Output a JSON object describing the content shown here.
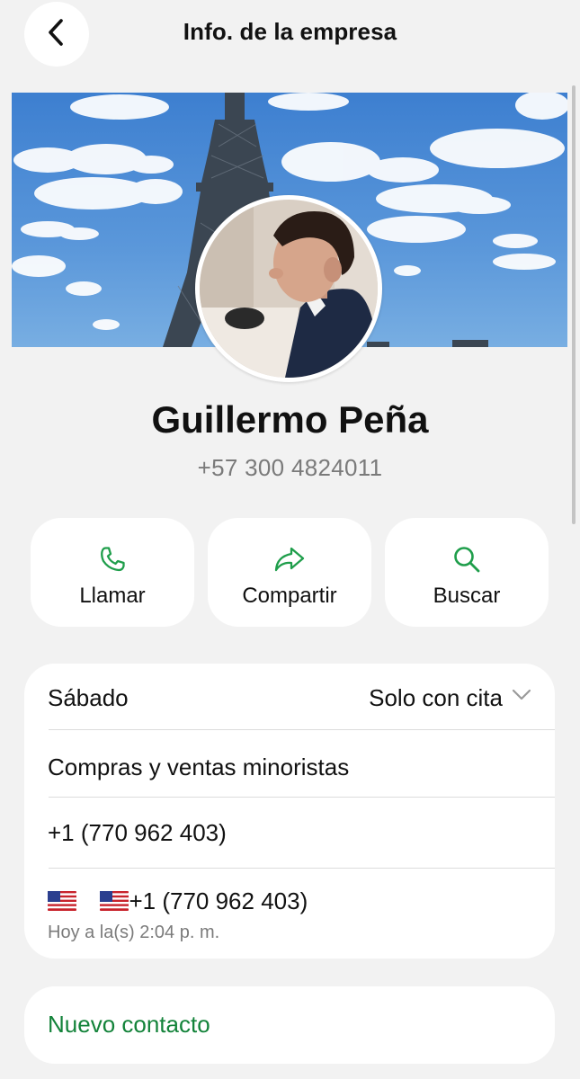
{
  "header": {
    "title": "Info. de la empresa",
    "back_icon": "chevron-left-icon"
  },
  "profile": {
    "name": "Guillermo Peña",
    "phone": "+57 300 4824011"
  },
  "actions": [
    {
      "label": "Llamar",
      "icon": "phone-icon"
    },
    {
      "label": "Compartir",
      "icon": "share-arrow-icon"
    },
    {
      "label": "Buscar",
      "icon": "search-icon"
    }
  ],
  "info": {
    "hours_day": "Sábado",
    "hours_value": "Solo con cita",
    "category": "Compras y ventas minoristas",
    "phone_business": "+1 (770 962 403)",
    "phone_flagged": "+1 (770 962 403)",
    "flag_icon": "us-flag-icon",
    "timestamp": "Hoy a la(s) 2:04 p. m."
  },
  "new_contact": "Nuevo contacto",
  "colors": {
    "accent_green": "#13833a",
    "icon_green": "#1f9e4b",
    "background": "#f2f2f2",
    "card": "#ffffff",
    "secondary_text": "#7a7a7a"
  }
}
